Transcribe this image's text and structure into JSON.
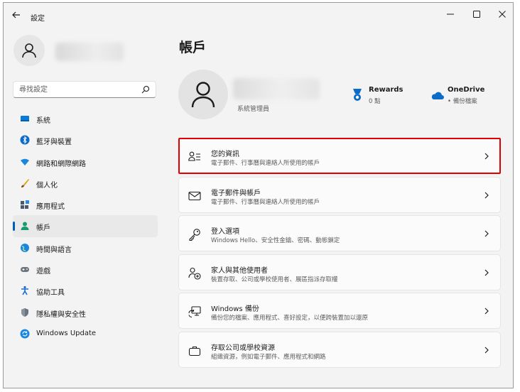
{
  "app": {
    "title": "設定"
  },
  "search": {
    "placeholder": "尋找設定"
  },
  "sidebar": {
    "items": [
      {
        "label": "系統",
        "icon": "system-icon"
      },
      {
        "label": "藍牙與裝置",
        "icon": "bluetooth-icon"
      },
      {
        "label": "網路和網際網路",
        "icon": "network-icon"
      },
      {
        "label": "個人化",
        "icon": "brush-icon"
      },
      {
        "label": "應用程式",
        "icon": "apps-icon"
      },
      {
        "label": "帳戶",
        "icon": "person-icon",
        "active": true
      },
      {
        "label": "時間與語言",
        "icon": "globe-icon"
      },
      {
        "label": "遊戲",
        "icon": "gamepad-icon"
      },
      {
        "label": "協助工具",
        "icon": "accessibility-icon"
      },
      {
        "label": "隱私權與安全性",
        "icon": "shield-icon"
      },
      {
        "label": "Windows Update",
        "icon": "update-icon"
      }
    ]
  },
  "main": {
    "title": "帳戶",
    "account": {
      "role": "系統管理員"
    },
    "badges": [
      {
        "title": "Rewards",
        "sub": "0 點"
      },
      {
        "title": "OneDrive",
        "sub": "• 備份檔案"
      }
    ],
    "cards": [
      {
        "title": "您的資訊",
        "sub": "電子郵件、行事曆與連絡人所使用的帳戶",
        "icon": "user-info-icon",
        "selected": true
      },
      {
        "title": "電子郵件與帳戶",
        "sub": "電子郵件、行事曆與連絡人所使用的帳戶",
        "icon": "mail-icon"
      },
      {
        "title": "登入選項",
        "sub": "Windows Hello、安全性金鑰、密碼、動態鎖定",
        "icon": "key-icon"
      },
      {
        "title": "家人與其他使用者",
        "sub": "裝置存取、公司或學校使用者、展區指派存取權",
        "icon": "family-icon"
      },
      {
        "title": "Windows 備份",
        "sub": "備份您的檔案、應用程式、喜好設定，以便跨裝置加以還原",
        "icon": "backup-icon"
      },
      {
        "title": "存取公司或學校資源",
        "sub": "組織資源，例如電子郵件、應用程式和網路",
        "icon": "briefcase-icon"
      }
    ]
  },
  "colors": {
    "accent": "#005fb8",
    "highlight": "#e00000",
    "window_bg": "#f3f3f3"
  }
}
